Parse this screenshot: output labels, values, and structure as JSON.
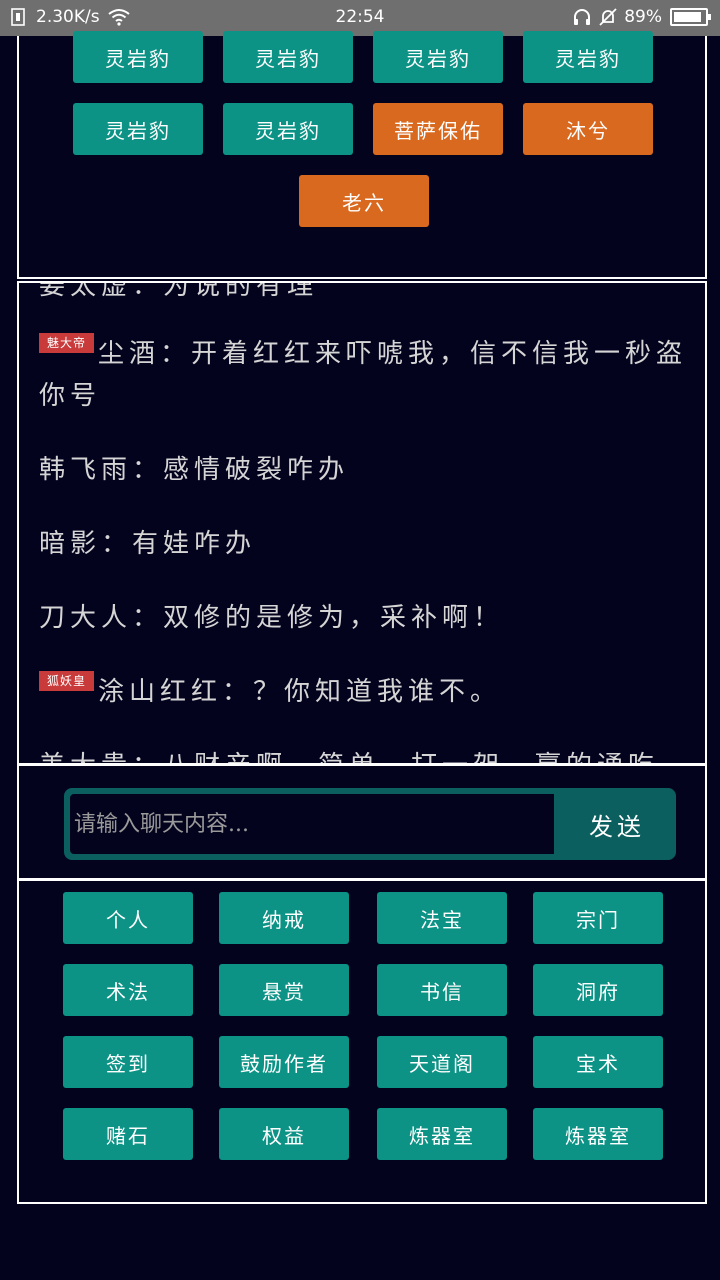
{
  "status_bar": {
    "speed": "2.30K/s",
    "time": "22:54",
    "battery": "89%",
    "battery_level": 0.89
  },
  "top_buttons": [
    {
      "label": "灵岩豹",
      "color": "teal"
    },
    {
      "label": "灵岩豹",
      "color": "teal"
    },
    {
      "label": "灵岩豹",
      "color": "teal"
    },
    {
      "label": "灵岩豹",
      "color": "teal"
    },
    {
      "label": "灵岩豹",
      "color": "teal"
    },
    {
      "label": "灵岩豹",
      "color": "teal"
    },
    {
      "label": "菩萨保佑",
      "color": "orange"
    },
    {
      "label": "沐兮",
      "color": "orange"
    },
    {
      "label": "老六",
      "color": "orange"
    }
  ],
  "chat": {
    "partial_top": "姜太虚：为说的有理",
    "messages": [
      {
        "tag": "魅大帝",
        "text": "尘酒：开着红红来吓唬我，信不信我一秒盗你号"
      },
      {
        "tag": "",
        "text": "韩飞雨：感情破裂咋办"
      },
      {
        "tag": "",
        "text": "暗影：有娃咋办"
      },
      {
        "tag": "",
        "text": "刀大人：双修的是修为，采补啊！"
      },
      {
        "tag": "狐妖皇",
        "text": "涂山红红：？你知道我谁不。"
      }
    ],
    "partial_bottom": "美大贵：八财产啊，简单，打一架，赢的通吃"
  },
  "input": {
    "placeholder": "请输入聊天内容...",
    "send_label": "发送"
  },
  "menu": [
    "个人",
    "纳戒",
    "法宝",
    "宗门",
    "术法",
    "悬赏",
    "书信",
    "洞府",
    "签到",
    "鼓励作者",
    "天道阁",
    "宝术",
    "赌石",
    "权益",
    "炼器室",
    "炼器室"
  ],
  "colors": {
    "background": "#03031e",
    "teal": "#0c9386",
    "orange": "#d9691e",
    "tag_red": "#c93a3a",
    "input_bar": "#0b5f5e"
  }
}
